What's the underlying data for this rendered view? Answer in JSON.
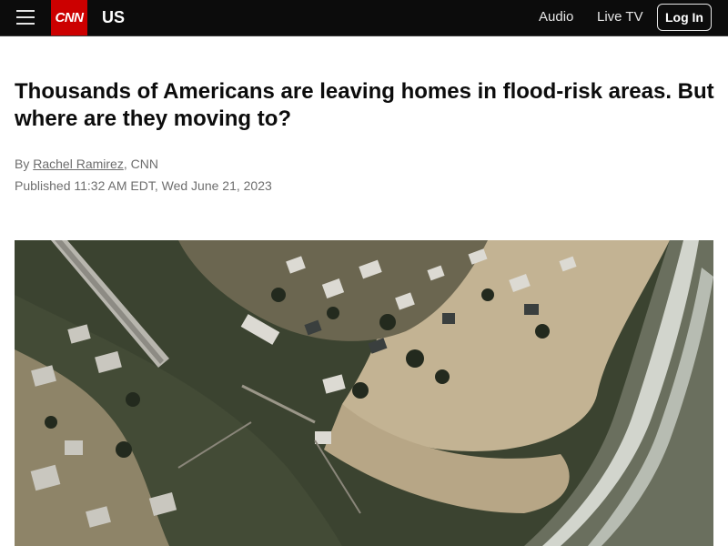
{
  "header": {
    "logo": "CNN",
    "section": "US",
    "nav": {
      "audio": "Audio",
      "live_tv": "Live TV"
    },
    "login_label": "Log In"
  },
  "article": {
    "headline": "Thousands of Americans are leaving homes in flood-risk areas. But where are they moving to?",
    "byline_prefix": "By ",
    "author": "Rachel Ramirez",
    "byline_suffix": ", CNN",
    "published": "Published 11:32 AM EDT, Wed June 21, 2023"
  },
  "colors": {
    "header_bg": "#0c0c0c",
    "brand_red": "#cc0000",
    "water": "#3d4530",
    "sand": "#c4b496",
    "ocean_foam": "#e8ebe6"
  }
}
